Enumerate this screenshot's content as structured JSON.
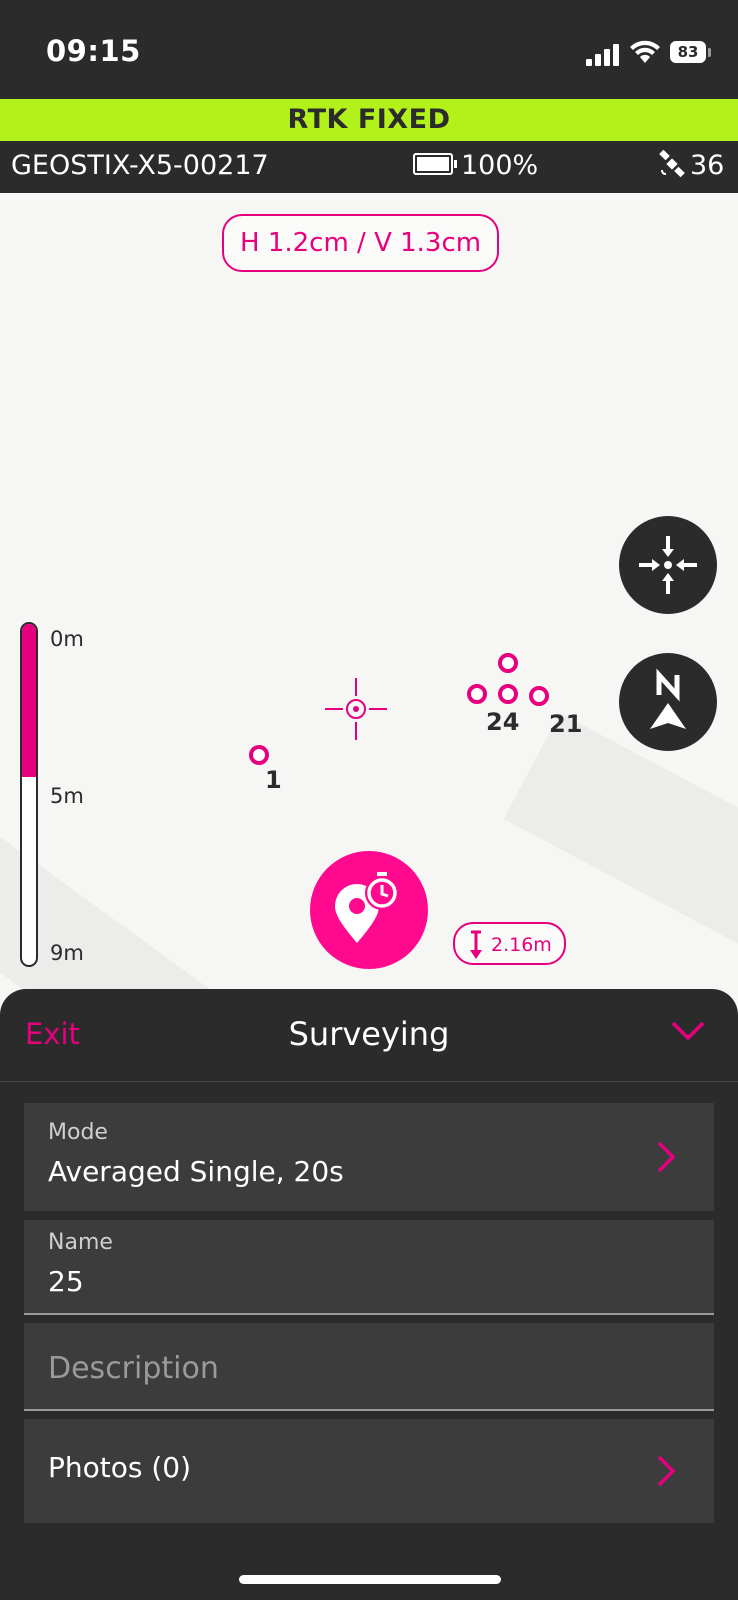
{
  "status_bar": {
    "time": "09:15",
    "phone_battery": "83"
  },
  "rtk_banner": "RTK FIXED",
  "device": {
    "name": "GEOSTIX-X5-00217",
    "battery": "100%",
    "satellites": "36"
  },
  "map": {
    "accuracy": "H 1.2cm / V 1.3cm",
    "depth_scale": {
      "labels": [
        "0m",
        "5m",
        "9m"
      ],
      "fill_fraction": 0.45
    },
    "point_labels": [
      "1",
      "24",
      "21"
    ],
    "antenna_height": "2.16m"
  },
  "sheet": {
    "exit_label": "Exit",
    "title": "Surveying",
    "mode_label": "Mode",
    "mode_value": "Averaged Single, 20s",
    "name_label": "Name",
    "name_value": "25",
    "description_placeholder": "Description",
    "photos_label": "Photos (0)"
  },
  "colors": {
    "accent": "#e6007e",
    "rtk_fixed": "#b2f21a",
    "dark": "#2b2b2b"
  },
  "icons": [
    "signal-icon",
    "wifi-icon",
    "battery-icon",
    "satellite-icon",
    "recenter-icon",
    "north-arrow-icon",
    "record-point-timer-icon",
    "height-arrow-icon",
    "chevron-down-icon",
    "chevron-right-icon"
  ]
}
